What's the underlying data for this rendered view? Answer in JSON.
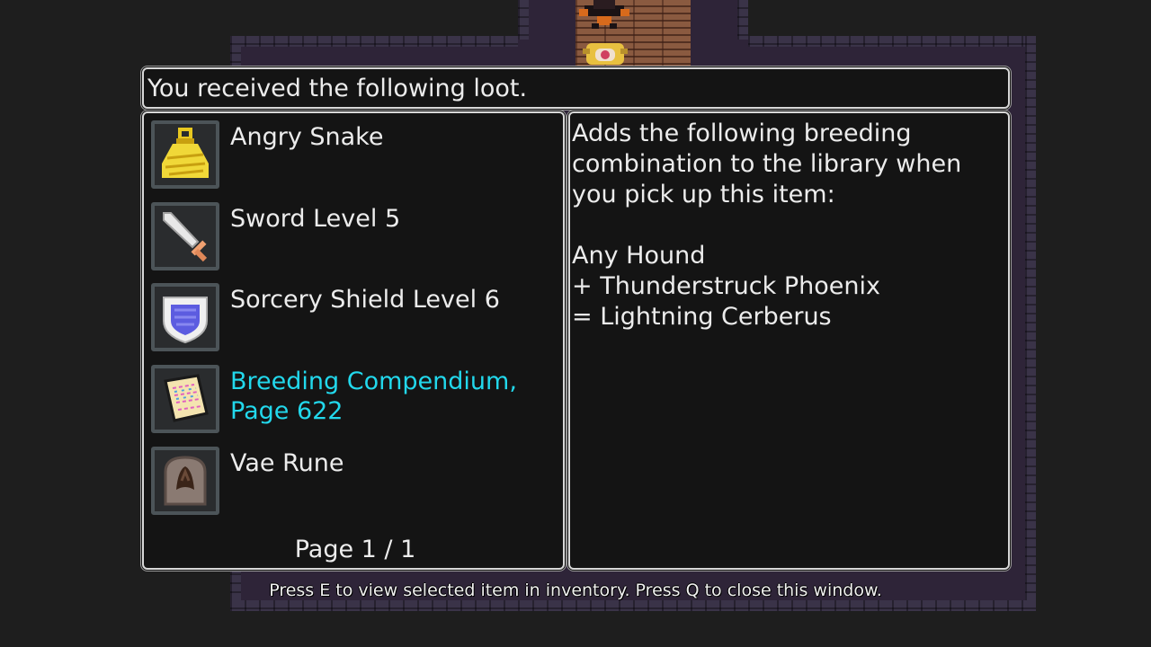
{
  "dialog": {
    "title": "You received the following loot.",
    "page_indicator": "Page 1 / 1"
  },
  "loot_items": [
    {
      "name": "Angry Snake",
      "icon": "yellow-bag-icon",
      "selected": false
    },
    {
      "name": "Sword Level 5",
      "icon": "sword-icon",
      "selected": false
    },
    {
      "name": "Sorcery Shield Level 6",
      "icon": "shield-icon",
      "selected": false
    },
    {
      "name": "Breeding Compendium, Page 622",
      "icon": "scroll-icon",
      "selected": true
    },
    {
      "name": "Vae Rune",
      "icon": "rune-stone-icon",
      "selected": false
    }
  ],
  "description": {
    "intro": "Adds the following breeding combination to the library when you pick up this item:",
    "line1": "Any Hound",
    "line2": "+ Thunderstruck Phoenix",
    "line3": "= Lightning Cerberus"
  },
  "help_text": "Press E to view selected item in inventory. Press Q to close this window.",
  "colors": {
    "highlight": "#22d8ec",
    "text": "#ececec",
    "panel_bg": "#141414",
    "panel_border": "#d8d8d8"
  }
}
